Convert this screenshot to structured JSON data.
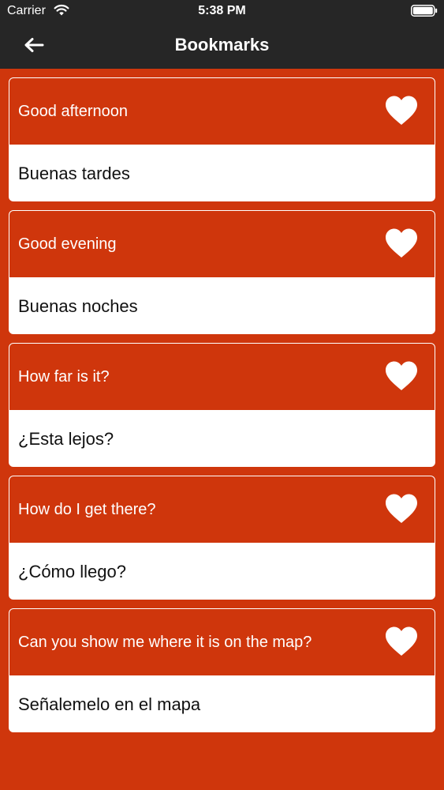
{
  "status_bar": {
    "carrier": "Carrier",
    "time": "5:38 PM"
  },
  "nav": {
    "title": "Bookmarks"
  },
  "bookmarks": [
    {
      "english": "Good afternoon",
      "spanish": "Buenas tardes"
    },
    {
      "english": "Good evening",
      "spanish": "Buenas noches"
    },
    {
      "english": "How far is it?",
      "spanish": "¿Esta lejos?"
    },
    {
      "english": "How do I get there?",
      "spanish": "¿Cómo llego?"
    },
    {
      "english": "Can you show me where it is on the map?",
      "spanish": "Señalemelo en el mapa"
    }
  ],
  "colors": {
    "accent": "#cf360c",
    "header": "#262626",
    "card": "#ffffff"
  },
  "icons": {
    "back": "arrow-left-icon",
    "bookmark": "heart-icon",
    "wifi": "wifi-icon",
    "battery": "battery-icon"
  }
}
